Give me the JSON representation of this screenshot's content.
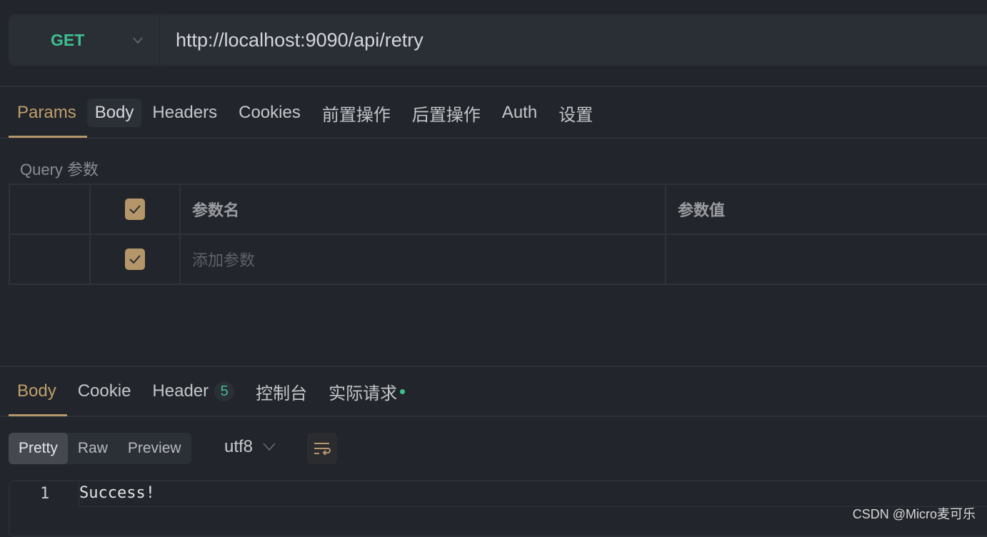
{
  "request": {
    "method": "GET",
    "url": "http://localhost:9090/api/retry"
  },
  "request_tabs": [
    {
      "label": "Params",
      "active": true
    },
    {
      "label": "Body"
    },
    {
      "label": "Headers"
    },
    {
      "label": "Cookies"
    },
    {
      "label": "前置操作"
    },
    {
      "label": "后置操作"
    },
    {
      "label": "Auth"
    },
    {
      "label": "设置"
    }
  ],
  "query": {
    "title": "Query 参数",
    "header_name": "参数名",
    "header_value": "参数值",
    "placeholder": "添加参数",
    "header_checked": true,
    "row_checked": true
  },
  "response_tabs": {
    "body": "Body",
    "cookie": "Cookie",
    "header": "Header",
    "header_count": "5",
    "console": "控制台",
    "actual": "实际请求"
  },
  "view_modes": [
    "Pretty",
    "Raw",
    "Preview"
  ],
  "selected_view": "Pretty",
  "encoding": "utf8",
  "response": {
    "line_number": "1",
    "text": "Success!"
  },
  "watermark": "CSDN @Micro麦可乐",
  "colors": {
    "accent": "#b5966a",
    "method": "#3fbf8f",
    "background": "#22252b"
  }
}
